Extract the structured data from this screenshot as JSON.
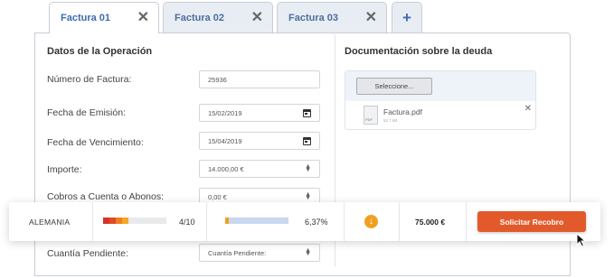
{
  "tabs": [
    {
      "label": "Factura 01",
      "close": "✕"
    },
    {
      "label": "Factura 02",
      "close": "✕"
    },
    {
      "label": "Factura 03",
      "close": "✕"
    }
  ],
  "add_tab_label": "+",
  "operation": {
    "title": "Datos de la Operación",
    "fields": {
      "invoice_number": {
        "label": "Número de Factura:",
        "value": "25936"
      },
      "issue_date": {
        "label": "Fecha de Emisión:",
        "value": "15/02/2019",
        "icon": "calendar-icon"
      },
      "due_date": {
        "label": "Fecha de Vencimiento:",
        "value": "15/04/2019",
        "icon": "calendar-icon"
      },
      "amount": {
        "label": "Importe:",
        "value": "14.000,00 €",
        "icon": "spinner-icon"
      },
      "payments": {
        "label": "Cobros a Cuenta o Abonos:",
        "value": "0,00 €",
        "icon": "spinner-icon"
      },
      "pending": {
        "label": "Cuantía Pendiente:",
        "placeholder": "Cuantía Pendiente:",
        "icon": "spinner-icon"
      }
    }
  },
  "documentation": {
    "title": "Documentación sobre la deuda",
    "select_button": "Seleccione...",
    "file_name": "Factura.pdf",
    "file_size": "52.7 kB",
    "file_icon_text": "PDF",
    "remove": "✕"
  },
  "summary": {
    "country": "ALEMANIA",
    "risk_score": "4/10",
    "risk_level": 0.4,
    "percentage": "6,37%",
    "percentage_level": 0.0637,
    "warning_icon": "arrow-down-circle-icon",
    "amount": "75.000 €",
    "action_button": "Solicitar Recobro"
  },
  "colors": {
    "accent": "#3e6cae",
    "action": "#e25a2c",
    "warning": "#f0a020",
    "risk_dark": "#d6322a",
    "risk_mid": "#ef7d22",
    "risk_light": "#f5a623",
    "bar_track": "#c9d7ef"
  }
}
